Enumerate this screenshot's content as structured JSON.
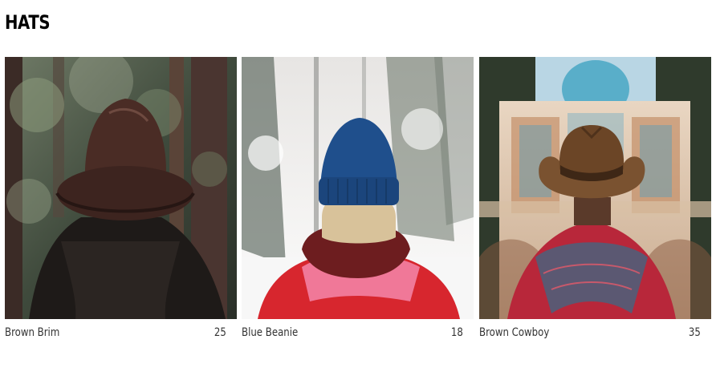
{
  "section": {
    "title": "HATS"
  },
  "products": [
    {
      "name": "Brown Brim",
      "price": "25",
      "image": "woman-brown-fedora-forest-photo"
    },
    {
      "name": "Blue Beanie",
      "price": "18",
      "image": "woman-blue-beanie-snow-photo"
    },
    {
      "name": "Brown Cowboy",
      "price": "35",
      "image": "man-brown-cowboy-hat-mosque-photo"
    }
  ]
}
